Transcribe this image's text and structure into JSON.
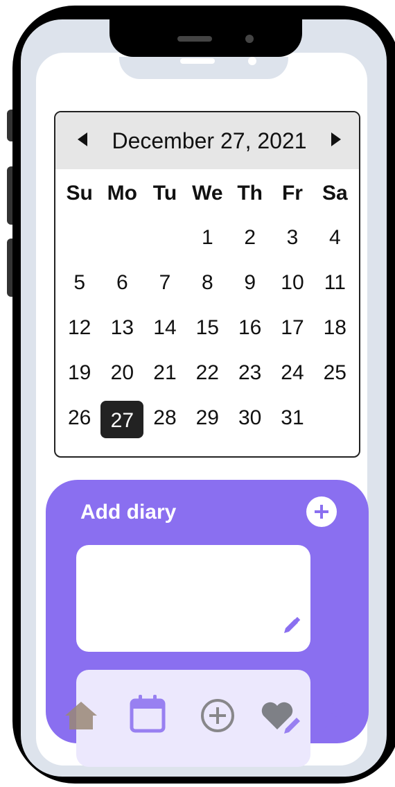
{
  "calendar": {
    "month_label": "December 27, 2021",
    "prev_icon": "chevron-left-icon",
    "next_icon": "chevron-right-icon",
    "weekdays": [
      "Su",
      "Mo",
      "Tu",
      "We",
      "Th",
      "Fr",
      "Sa"
    ],
    "days": [
      "",
      "",
      "",
      "1",
      "2",
      "3",
      "4",
      "5",
      "6",
      "7",
      "8",
      "9",
      "10",
      "11",
      "12",
      "13",
      "14",
      "15",
      "16",
      "17",
      "18",
      "19",
      "20",
      "21",
      "22",
      "23",
      "24",
      "25",
      "26",
      "27",
      "28",
      "29",
      "30",
      "31",
      ""
    ],
    "selected_day": "27"
  },
  "diary": {
    "title": "Add diary",
    "add_icon": "plus-circle-icon",
    "edit_icon": "pencil-icon"
  },
  "nav": {
    "items": [
      "home-icon",
      "calendar-icon",
      "add-circle-icon",
      "heart-edit-icon",
      "profile-icon"
    ]
  },
  "colors": {
    "accent": "#8a6ff0",
    "selected_day_bg": "#222222",
    "header_bg": "#e6e6e6"
  }
}
